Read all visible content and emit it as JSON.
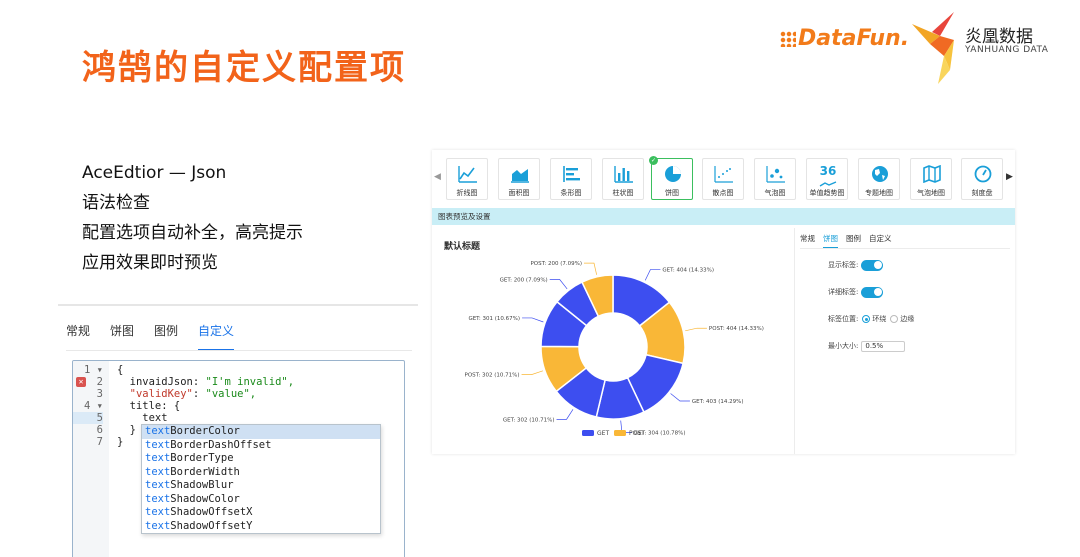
{
  "slide": {
    "title": "鸿鹄的自定义配置项",
    "logo_datafun": "DataFun.",
    "logo_yanhuang_cn": "炎凰数据",
    "logo_yanhuang_en": "YANHUANG DATA",
    "bullets": [
      "AceEdtior — Json",
      "语法检查",
      "配置选项自动补全，高亮提示",
      "应用效果即时预览"
    ]
  },
  "editor": {
    "tabs": [
      "常规",
      "饼图",
      "图例",
      "自定义"
    ],
    "active_tab": "自定义",
    "lines": [
      {
        "num": "1",
        "fold": "▾",
        "text": "{"
      },
      {
        "num": "2",
        "error": true,
        "key": "invaidJson",
        "value": "\"I'm invalid\","
      },
      {
        "num": "3",
        "key": "\"validKey\"",
        "value": "\"value\","
      },
      {
        "num": "4",
        "fold": "▾",
        "text": "  title: {"
      },
      {
        "num": "5",
        "text": "    text"
      },
      {
        "num": "6",
        "text": "  }"
      },
      {
        "num": "7",
        "text": "}"
      }
    ],
    "autocomplete": {
      "prefix": "text",
      "items": [
        "BorderColor",
        "BorderDashOffset",
        "BorderType",
        "BorderWidth",
        "ShadowBlur",
        "ShadowColor",
        "ShadowOffsetX",
        "ShadowOffsetY"
      ]
    }
  },
  "chart_panel": {
    "chart_types": [
      {
        "label": "折线图",
        "icon": "line-chart-icon"
      },
      {
        "label": "面积图",
        "icon": "area-chart-icon"
      },
      {
        "label": "条形图",
        "icon": "bar-chart-horizontal-icon"
      },
      {
        "label": "柱状图",
        "icon": "column-chart-icon"
      },
      {
        "label": "饼图",
        "icon": "pie-chart-icon",
        "selected": true
      },
      {
        "label": "散点图",
        "icon": "scatter-chart-icon"
      },
      {
        "label": "气泡图",
        "icon": "bubble-chart-icon"
      },
      {
        "label": "单值趋势图",
        "icon": "single-value-icon",
        "value": "36"
      },
      {
        "label": "专题地图",
        "icon": "globe-icon"
      },
      {
        "label": "气泡地图",
        "icon": "map-icon"
      },
      {
        "label": "刻度盘",
        "icon": "gauge-icon"
      }
    ],
    "preview_header": "图表预览及设置",
    "settings": {
      "tabs": [
        "常规",
        "饼图",
        "图例",
        "自定义"
      ],
      "active_tab": "饼图",
      "show_label": "显示标签:",
      "detail_label": "详细标签:",
      "label_position": "标签位置:",
      "position_options": [
        "环绕",
        "边缘"
      ],
      "min_size_label": "最小大小:",
      "min_size_value": "0.5%"
    }
  },
  "chart_data": {
    "type": "pie",
    "title": "默认标题",
    "donut": true,
    "slices": [
      {
        "label": "GET: 404 (14.33%)",
        "value": 14.33,
        "group": "GET"
      },
      {
        "label": "POST: 404 (14.33%)",
        "value": 14.33,
        "group": "POST"
      },
      {
        "label": "GET: 403 (14.29%)",
        "value": 14.29,
        "group": "GET"
      },
      {
        "label": "GET: 304 (10.78%)",
        "value": 10.78,
        "group": "GET"
      },
      {
        "label": "GET: 302 (10.71%)",
        "value": 10.71,
        "group": "GET"
      },
      {
        "label": "POST: 302 (10.71%)",
        "value": 10.71,
        "group": "POST"
      },
      {
        "label": "GET: 301 (10.67%)",
        "value": 10.67,
        "group": "GET"
      },
      {
        "label": "GET: 200 (7.09%)",
        "value": 7.09,
        "group": "GET"
      },
      {
        "label": "POST: 200 (7.09%)",
        "value": 7.09,
        "group": "POST"
      }
    ],
    "legend": [
      "GET",
      "POST"
    ],
    "legend_position": "bottom",
    "colors": {
      "GET": "#3d4ef0",
      "POST": "#f9b737"
    }
  }
}
